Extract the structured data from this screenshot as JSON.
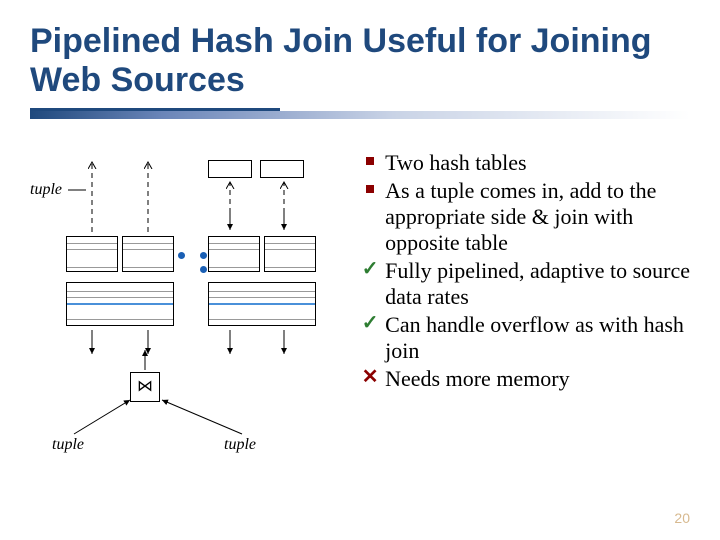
{
  "title": "Pipelined Hash Join Useful for Joining Web Sources",
  "bullets": [
    {
      "marker": "square",
      "text": "Two hash tables"
    },
    {
      "marker": "square",
      "text": "As a tuple comes in, add to the appropriate side & join with opposite table"
    },
    {
      "marker": "check",
      "text": "Fully pipelined, adaptive to source data rates"
    },
    {
      "marker": "check",
      "text": "Can handle overflow as with hash join"
    },
    {
      "marker": "cross",
      "text": "Needs more memory"
    }
  ],
  "diagram": {
    "label_top": "tuple",
    "label_bottom_left": "tuple",
    "label_bottom_right": "tuple",
    "join_symbol": "⋈"
  },
  "slide_number": "20"
}
